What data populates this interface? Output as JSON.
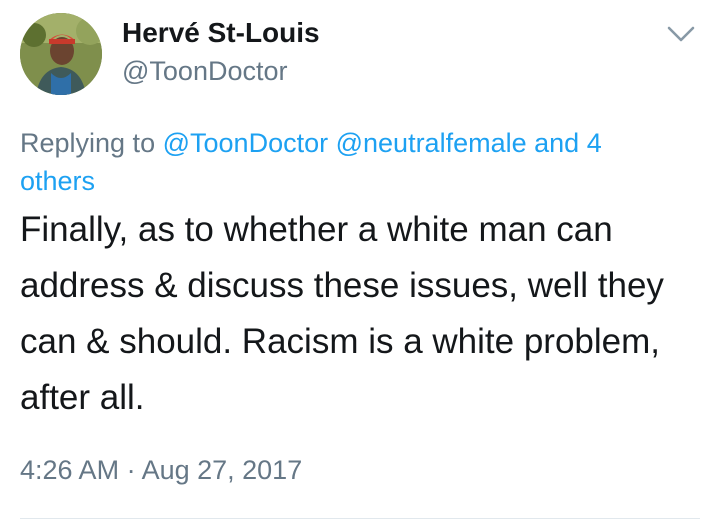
{
  "tweet": {
    "author": {
      "display_name": "Hervé St-Louis",
      "handle": "@ToonDoctor"
    },
    "reply_context": {
      "prefix": "Replying to",
      "mentions": [
        "@ToonDoctor",
        "@neutralfemale"
      ],
      "others": "and 4 others"
    },
    "text": "Finally, as to whether a white man can address & discuss these issues, well they can & should. Racism is a white problem, after all.",
    "timestamp": "4:26 AM · Aug 27, 2017"
  },
  "colors": {
    "text": "#14171a",
    "secondary": "#657786",
    "link": "#1da1f2",
    "divider": "#e1e8ed"
  },
  "icons": {
    "menu": "chevron-down-icon"
  }
}
